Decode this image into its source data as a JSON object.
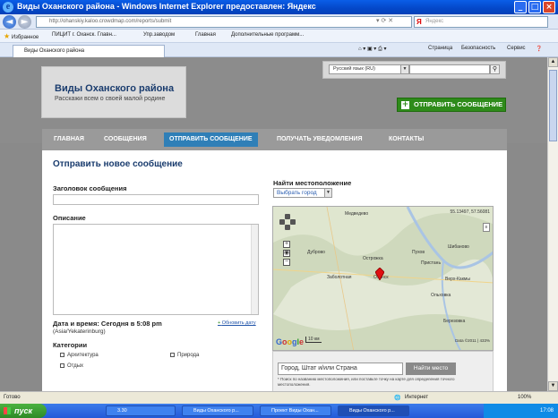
{
  "window": {
    "title": "Виды Оханского района - Windows Internet Explorer предоставлен: Яндекс"
  },
  "address": {
    "url": "http://ohanskiy.kaloo.crowdmap.com/reports/submit",
    "yandex_placeholder": "Яндекс"
  },
  "favorites": {
    "label": "Избранное",
    "items": [
      "ПИЦИТ г. Оханск. Главн...",
      "Упр.заводом",
      "Главная",
      "Дополнительные программ..."
    ]
  },
  "tab": {
    "title": "Виды Оханского района"
  },
  "toolbar": {
    "page": "Страница",
    "safety": "Безопасность",
    "tools": "Сервис"
  },
  "page": {
    "language_select": "Русский язык (RU)",
    "site_title": "Виды Оханского района",
    "site_tagline": "Расскажи всем о своей малой родине",
    "send_button": "ОТПРАВИТЬ СООБЩЕНИЕ",
    "nav": [
      "ГЛАВНАЯ",
      "СООБЩЕНИЯ",
      "ОТПРАВИТЬ СООБЩЕНИЕ",
      "ПОЛУЧАТЬ УВЕДОМЛЕНИЯ",
      "КОНТАКТЫ"
    ],
    "form_title": "Отправить новое сообщение",
    "subject_label": "Заголовок сообщения",
    "description_label": "Описание",
    "datetime_label": "Дата и время: Сегодня в 5:08 pm",
    "timezone": "(Asia/Yekaterinburg)",
    "update_link": "Обновить дату",
    "categories_label": "Категории",
    "categories": [
      "Архитектура",
      "Отдых",
      "Природа"
    ],
    "location_label": "Найти местоположение",
    "city_select": "Выбрать город",
    "location_input": "Город, Штат и/или Страна",
    "find_button": "Найти место",
    "location_hint": "* Поиск по названию местоположения, или поставьте точку на карте для определения точного местоположения."
  },
  "map": {
    "coords": "55.13497, 57.56081",
    "towns": [
      "Медведево",
      "Дуброво",
      "Острожка",
      "Пухов",
      "Заболотная",
      "Оханск",
      "Пристань",
      "Ольховка",
      "Шибаново",
      "Березовка",
      "Верх-Какмы"
    ],
    "scale": "10 км",
    "copyright": "Data ©2011 | 433%",
    "google": "Google"
  },
  "status": {
    "left": "Готово",
    "zone": "Интернет",
    "zoom": "100%"
  },
  "taskbar": {
    "start": "пуск",
    "tasks": [
      "3.30",
      "Виды Оханского р...",
      "Проект Виды Охан...",
      "Виды Оханского р..."
    ],
    "clock": "17:08"
  }
}
